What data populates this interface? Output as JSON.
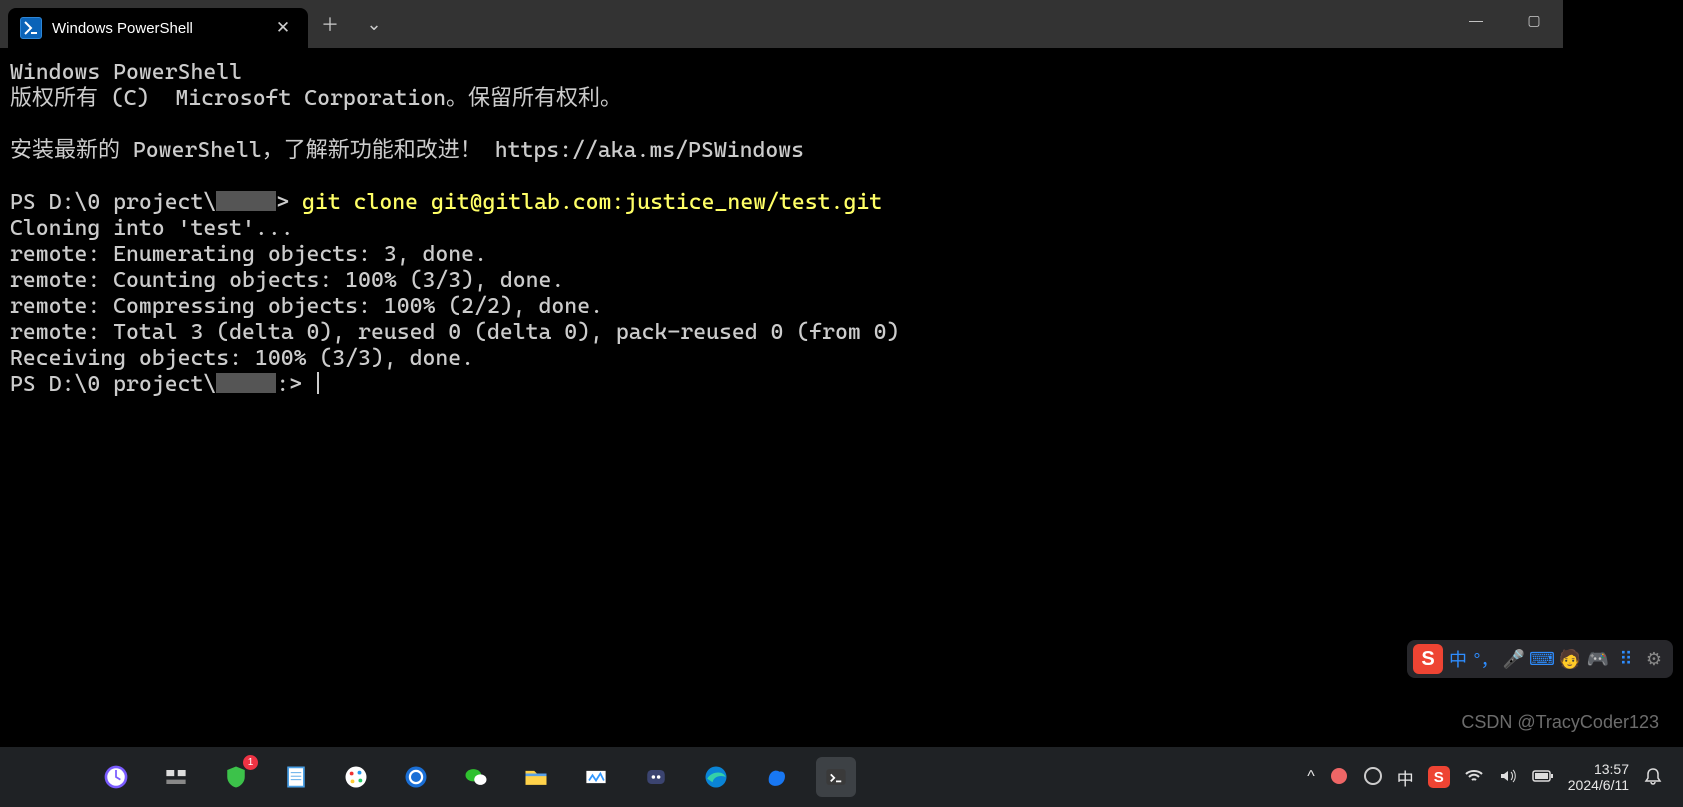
{
  "window": {
    "tab_title": "Windows PowerShell",
    "close_glyph": "✕",
    "new_tab_glyph": "＋",
    "dropdown_glyph": "⌄",
    "minimize_glyph": "—",
    "maximize_glyph": "▢"
  },
  "terminal": {
    "line_header1": "Windows PowerShell",
    "line_header2": "版权所有 (C)  Microsoft Corporation。保留所有权利。",
    "line_tip": "安装最新的 PowerShell，了解新功能和改进！ https://aka.ms/PSWindows",
    "prompt_path_prefix": "PS D:\\0 project\\",
    "prompt_arrow": "> ",
    "command": "git clone git@gitlab.com:justice_new/test.git",
    "out1": "Cloning into 'test'...",
    "out2": "remote: Enumerating objects: 3, done.",
    "out3": "remote: Counting objects: 100% (3/3), done.",
    "out4": "remote: Compressing objects: 100% (2/2), done.",
    "out5": "remote: Total 3 (delta 0), reused 0 (delta 0), pack-reused 0 (from 0)",
    "out6": "Receiving objects: 100% (3/3), done.",
    "prompt2_suffix": ":> "
  },
  "ime_overlay": {
    "sogou": "S",
    "lang": "中",
    "punct": "°，",
    "mic": "🎤",
    "kbd": "⌨",
    "person": "🧑",
    "game": "🎮",
    "grid": "⠿",
    "gear": "⚙"
  },
  "watermark": "CSDN @TracyCoder123",
  "taskbar": {
    "badge1": "1",
    "tray": {
      "chev": "^",
      "ime": "中",
      "time": "13:57",
      "date": "2024/6/11"
    }
  }
}
